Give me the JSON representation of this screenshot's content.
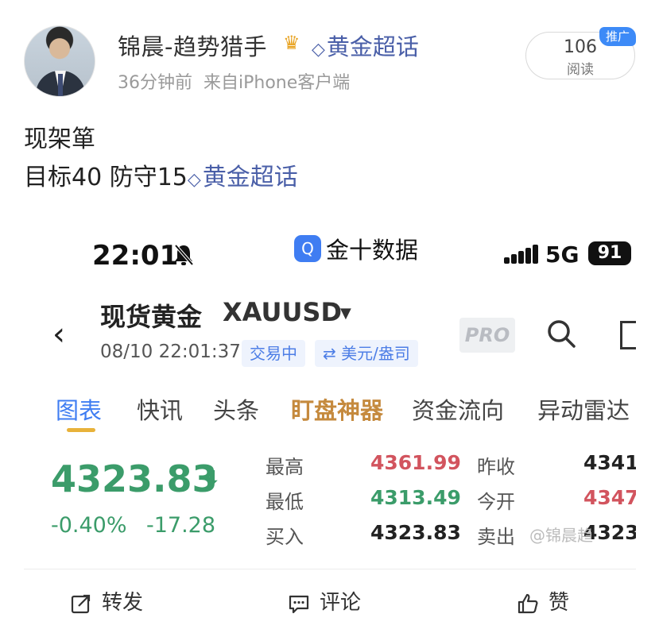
{
  "post": {
    "author": "锦晨-趋势猎手",
    "topic_tag": "黄金超话",
    "time_ago": "36分钟前",
    "source": "来自iPhone客户端",
    "reads_count": "106",
    "reads_label": "阅读",
    "promo_badge": "推广",
    "text_line1": "现架箪",
    "text_line2": "目标40 防守15",
    "text_tag": "黄金超话"
  },
  "screenshot": {
    "status_bar": {
      "time": "22:01",
      "app_name": "金十数据",
      "app_icon_glyph": "Q",
      "network": "5G",
      "battery": "91"
    },
    "instrument": {
      "name": "现货黄金",
      "code": "XAUUSD",
      "timestamp": "08/10 22:01:37",
      "status": "交易中",
      "currency": "⇄ 美元/盎司",
      "pro_label": "PRO"
    },
    "tabs": [
      "图表",
      "快讯",
      "头条",
      "盯盘神器",
      "资金流向",
      "异动雷达"
    ],
    "quote": {
      "price": "4323.83",
      "change_pct": "-0.40%",
      "change_abs": "-17.28",
      "high_label": "最高",
      "high": "4361.99",
      "low_label": "最低",
      "low": "4313.49",
      "bid_label": "买入",
      "bid": "4323.83",
      "prev_close_label": "昨收",
      "prev_close": "4341.",
      "open_label": "今开",
      "open": "4347.",
      "ask_label": "卖出",
      "ask": "4323."
    },
    "watermark": "@锦晨趋"
  },
  "actions": {
    "repost": "转发",
    "comment": "评论",
    "like": "赞"
  },
  "colors": {
    "link_blue": "#4a5fa8",
    "accent_blue": "#3f7df2",
    "down_green": "#3b9c6a",
    "up_red": "#d2545e",
    "gold": "#c58a3e"
  }
}
